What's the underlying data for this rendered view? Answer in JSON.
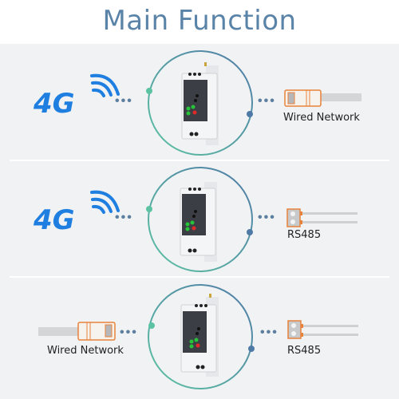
{
  "title": "Main Function",
  "colors": {
    "title": "#5a83a8",
    "ring_teal": "#5cc3a2",
    "ring_blue": "#4f7aa6",
    "signal_blue": "#1e7fe0",
    "connector_orange": "#e8813a",
    "dots": "#5c7f9f"
  },
  "panels": [
    {
      "left": {
        "type": "4g-icon",
        "text": "4G"
      },
      "dots_left": "•••",
      "dots_right": "•••",
      "right": {
        "type": "ethernet-connector-icon",
        "label": "Wired Network"
      }
    },
    {
      "left": {
        "type": "4g-icon",
        "text": "4G"
      },
      "dots_left": "•••",
      "dots_right": "•••",
      "right": {
        "type": "rs485-terminal-icon",
        "label": "RS485"
      }
    },
    {
      "left": {
        "type": "ethernet-connector-icon",
        "label": "Wired Network"
      },
      "dots_left": "•••",
      "dots_right": "•••",
      "right": {
        "type": "rs485-terminal-icon",
        "label": "RS485"
      }
    }
  ]
}
